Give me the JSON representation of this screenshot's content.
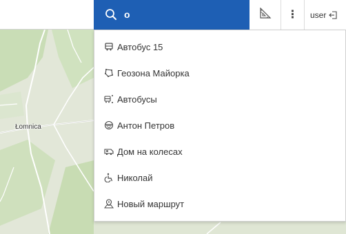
{
  "map": {
    "place_label": "Łomnica"
  },
  "search": {
    "value": "o",
    "placeholder": ""
  },
  "user": {
    "name": "user"
  },
  "results": [
    {
      "icon": "bus-icon",
      "label": "Автобус 15"
    },
    {
      "icon": "geofence-icon",
      "label": "Геозона Майорка"
    },
    {
      "icon": "bus-group-icon",
      "label": "Автобусы"
    },
    {
      "icon": "face-icon",
      "label": "Антон Петров"
    },
    {
      "icon": "motorhome-icon",
      "label": "Дом на колесах"
    },
    {
      "icon": "wheelchair-icon",
      "label": "Николай"
    },
    {
      "icon": "route-icon",
      "label": "Новый маршрут"
    }
  ],
  "colors": {
    "search_bg": "#1e5fb4",
    "map_bg": "#dfe6d4",
    "forest": "#c7dcb4",
    "road": "#ffffff"
  }
}
